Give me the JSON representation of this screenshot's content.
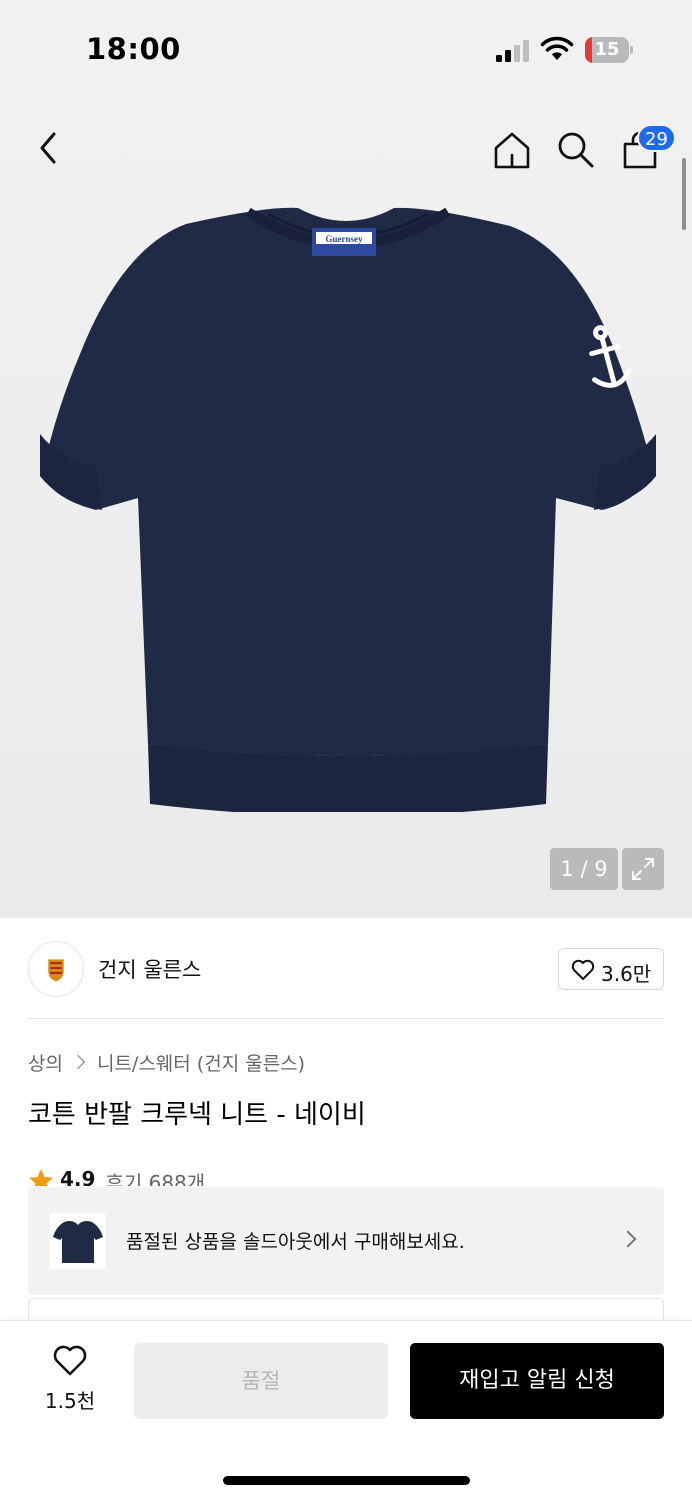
{
  "status_bar": {
    "time": "18:00",
    "battery_percent": "15",
    "battery_level": 0.15
  },
  "header": {
    "cart_badge": "29"
  },
  "gallery": {
    "page_counter": "1 / 9"
  },
  "brand": {
    "name": "건지 울른스",
    "like_count": "3.6만"
  },
  "breadcrumb": {
    "items": [
      "상의",
      "니트/스웨터 (건지 울른스)"
    ]
  },
  "product": {
    "title": "코튼 반팔 크루넥 니트 - 네이비",
    "rating": "4.9",
    "review_label": "후기 688개",
    "label_text": "Guernsey"
  },
  "soldout_banner": {
    "text": "품절된 상품을 솔드아웃에서 구매해보세요."
  },
  "bottom_bar": {
    "wish_count": "1.5천",
    "soldout_label": "품절",
    "restock_label": "재입고 알림 신청"
  },
  "colors": {
    "accent_blue": "#1e6bf0",
    "knit_navy": "#1f2a47",
    "star": "#f39c12"
  }
}
